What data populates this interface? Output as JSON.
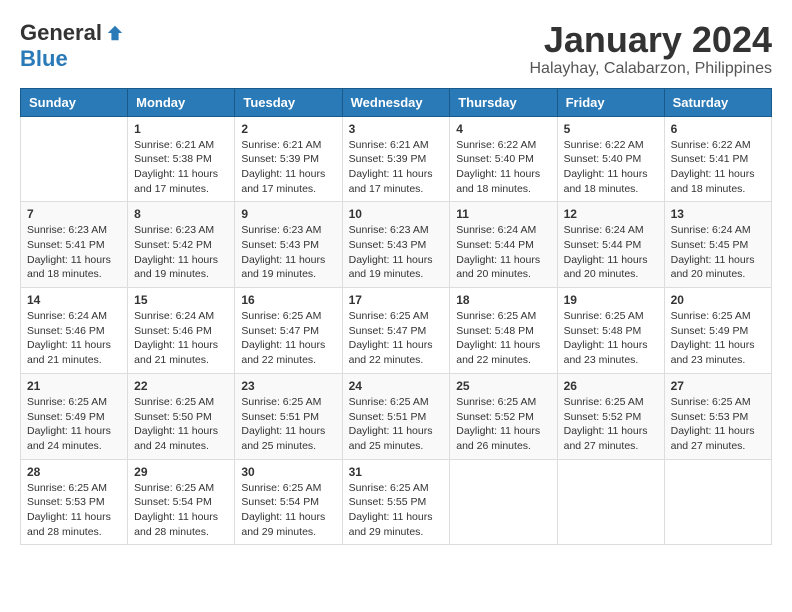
{
  "logo": {
    "general": "General",
    "blue": "Blue"
  },
  "title": {
    "month": "January 2024",
    "location": "Halayhay, Calabarzon, Philippines"
  },
  "headers": [
    "Sunday",
    "Monday",
    "Tuesday",
    "Wednesday",
    "Thursday",
    "Friday",
    "Saturday"
  ],
  "weeks": [
    [
      {
        "day": "",
        "sunrise": "",
        "sunset": "",
        "daylight": ""
      },
      {
        "day": "1",
        "sunrise": "Sunrise: 6:21 AM",
        "sunset": "Sunset: 5:38 PM",
        "daylight": "Daylight: 11 hours and 17 minutes."
      },
      {
        "day": "2",
        "sunrise": "Sunrise: 6:21 AM",
        "sunset": "Sunset: 5:39 PM",
        "daylight": "Daylight: 11 hours and 17 minutes."
      },
      {
        "day": "3",
        "sunrise": "Sunrise: 6:21 AM",
        "sunset": "Sunset: 5:39 PM",
        "daylight": "Daylight: 11 hours and 17 minutes."
      },
      {
        "day": "4",
        "sunrise": "Sunrise: 6:22 AM",
        "sunset": "Sunset: 5:40 PM",
        "daylight": "Daylight: 11 hours and 18 minutes."
      },
      {
        "day": "5",
        "sunrise": "Sunrise: 6:22 AM",
        "sunset": "Sunset: 5:40 PM",
        "daylight": "Daylight: 11 hours and 18 minutes."
      },
      {
        "day": "6",
        "sunrise": "Sunrise: 6:22 AM",
        "sunset": "Sunset: 5:41 PM",
        "daylight": "Daylight: 11 hours and 18 minutes."
      }
    ],
    [
      {
        "day": "7",
        "sunrise": "Sunrise: 6:23 AM",
        "sunset": "Sunset: 5:41 PM",
        "daylight": "Daylight: 11 hours and 18 minutes."
      },
      {
        "day": "8",
        "sunrise": "Sunrise: 6:23 AM",
        "sunset": "Sunset: 5:42 PM",
        "daylight": "Daylight: 11 hours and 19 minutes."
      },
      {
        "day": "9",
        "sunrise": "Sunrise: 6:23 AM",
        "sunset": "Sunset: 5:43 PM",
        "daylight": "Daylight: 11 hours and 19 minutes."
      },
      {
        "day": "10",
        "sunrise": "Sunrise: 6:23 AM",
        "sunset": "Sunset: 5:43 PM",
        "daylight": "Daylight: 11 hours and 19 minutes."
      },
      {
        "day": "11",
        "sunrise": "Sunrise: 6:24 AM",
        "sunset": "Sunset: 5:44 PM",
        "daylight": "Daylight: 11 hours and 20 minutes."
      },
      {
        "day": "12",
        "sunrise": "Sunrise: 6:24 AM",
        "sunset": "Sunset: 5:44 PM",
        "daylight": "Daylight: 11 hours and 20 minutes."
      },
      {
        "day": "13",
        "sunrise": "Sunrise: 6:24 AM",
        "sunset": "Sunset: 5:45 PM",
        "daylight": "Daylight: 11 hours and 20 minutes."
      }
    ],
    [
      {
        "day": "14",
        "sunrise": "Sunrise: 6:24 AM",
        "sunset": "Sunset: 5:46 PM",
        "daylight": "Daylight: 11 hours and 21 minutes."
      },
      {
        "day": "15",
        "sunrise": "Sunrise: 6:24 AM",
        "sunset": "Sunset: 5:46 PM",
        "daylight": "Daylight: 11 hours and 21 minutes."
      },
      {
        "day": "16",
        "sunrise": "Sunrise: 6:25 AM",
        "sunset": "Sunset: 5:47 PM",
        "daylight": "Daylight: 11 hours and 22 minutes."
      },
      {
        "day": "17",
        "sunrise": "Sunrise: 6:25 AM",
        "sunset": "Sunset: 5:47 PM",
        "daylight": "Daylight: 11 hours and 22 minutes."
      },
      {
        "day": "18",
        "sunrise": "Sunrise: 6:25 AM",
        "sunset": "Sunset: 5:48 PM",
        "daylight": "Daylight: 11 hours and 22 minutes."
      },
      {
        "day": "19",
        "sunrise": "Sunrise: 6:25 AM",
        "sunset": "Sunset: 5:48 PM",
        "daylight": "Daylight: 11 hours and 23 minutes."
      },
      {
        "day": "20",
        "sunrise": "Sunrise: 6:25 AM",
        "sunset": "Sunset: 5:49 PM",
        "daylight": "Daylight: 11 hours and 23 minutes."
      }
    ],
    [
      {
        "day": "21",
        "sunrise": "Sunrise: 6:25 AM",
        "sunset": "Sunset: 5:49 PM",
        "daylight": "Daylight: 11 hours and 24 minutes."
      },
      {
        "day": "22",
        "sunrise": "Sunrise: 6:25 AM",
        "sunset": "Sunset: 5:50 PM",
        "daylight": "Daylight: 11 hours and 24 minutes."
      },
      {
        "day": "23",
        "sunrise": "Sunrise: 6:25 AM",
        "sunset": "Sunset: 5:51 PM",
        "daylight": "Daylight: 11 hours and 25 minutes."
      },
      {
        "day": "24",
        "sunrise": "Sunrise: 6:25 AM",
        "sunset": "Sunset: 5:51 PM",
        "daylight": "Daylight: 11 hours and 25 minutes."
      },
      {
        "day": "25",
        "sunrise": "Sunrise: 6:25 AM",
        "sunset": "Sunset: 5:52 PM",
        "daylight": "Daylight: 11 hours and 26 minutes."
      },
      {
        "day": "26",
        "sunrise": "Sunrise: 6:25 AM",
        "sunset": "Sunset: 5:52 PM",
        "daylight": "Daylight: 11 hours and 27 minutes."
      },
      {
        "day": "27",
        "sunrise": "Sunrise: 6:25 AM",
        "sunset": "Sunset: 5:53 PM",
        "daylight": "Daylight: 11 hours and 27 minutes."
      }
    ],
    [
      {
        "day": "28",
        "sunrise": "Sunrise: 6:25 AM",
        "sunset": "Sunset: 5:53 PM",
        "daylight": "Daylight: 11 hours and 28 minutes."
      },
      {
        "day": "29",
        "sunrise": "Sunrise: 6:25 AM",
        "sunset": "Sunset: 5:54 PM",
        "daylight": "Daylight: 11 hours and 28 minutes."
      },
      {
        "day": "30",
        "sunrise": "Sunrise: 6:25 AM",
        "sunset": "Sunset: 5:54 PM",
        "daylight": "Daylight: 11 hours and 29 minutes."
      },
      {
        "day": "31",
        "sunrise": "Sunrise: 6:25 AM",
        "sunset": "Sunset: 5:55 PM",
        "daylight": "Daylight: 11 hours and 29 minutes."
      },
      {
        "day": "",
        "sunrise": "",
        "sunset": "",
        "daylight": ""
      },
      {
        "day": "",
        "sunrise": "",
        "sunset": "",
        "daylight": ""
      },
      {
        "day": "",
        "sunrise": "",
        "sunset": "",
        "daylight": ""
      }
    ]
  ]
}
